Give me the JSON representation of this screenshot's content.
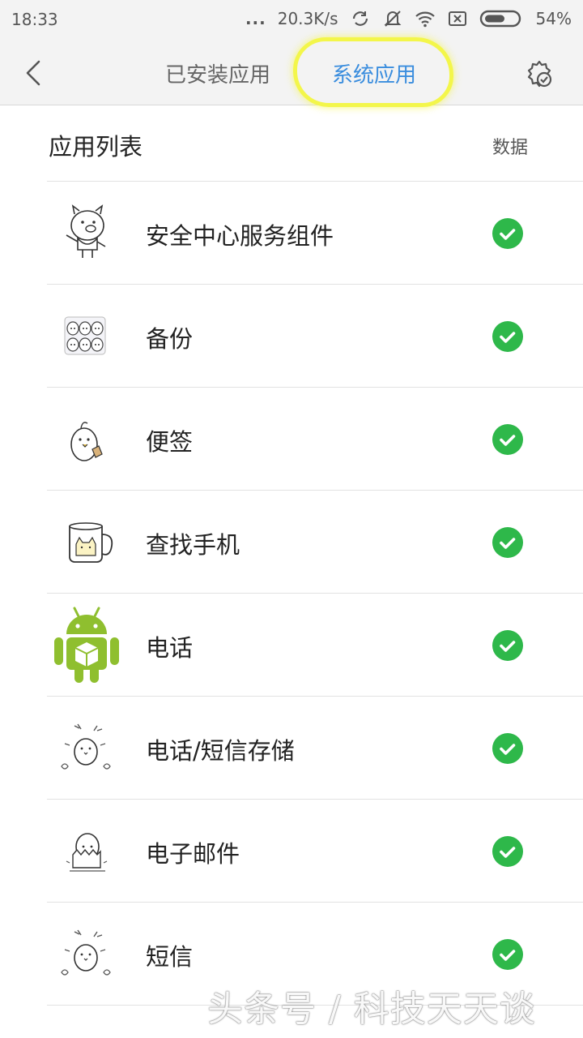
{
  "status_bar": {
    "time": "18:33",
    "dots": "...",
    "speed": "20.3K/s",
    "battery": "54%"
  },
  "header": {
    "tabs": [
      {
        "label": "已安装应用",
        "active": false
      },
      {
        "label": "系统应用",
        "active": true
      }
    ],
    "active_color": "#3a8dde",
    "highlight_color": "#f3f64a"
  },
  "list": {
    "title": "应用列表",
    "data_label": "数据",
    "items": [
      {
        "name": "安全中心服务组件",
        "icon": "pig-cartoon-icon",
        "checked": true
      },
      {
        "name": "备份",
        "icon": "egg-group-cartoon-icon",
        "checked": true
      },
      {
        "name": "便签",
        "icon": "chick-cartoon-icon",
        "checked": true
      },
      {
        "name": "查找手机",
        "icon": "mug-cat-cartoon-icon",
        "checked": true
      },
      {
        "name": "电话",
        "icon": "android-robot-icon",
        "checked": true
      },
      {
        "name": "电话/短信存储",
        "icon": "chick-party-cartoon-icon",
        "checked": true
      },
      {
        "name": "电子邮件",
        "icon": "hatching-egg-cartoon-icon",
        "checked": true
      },
      {
        "name": "短信",
        "icon": "chick-party-cartoon-icon",
        "checked": true
      }
    ],
    "check_color": "#2eb84a"
  },
  "watermark": "头条号 / 科技天天谈"
}
